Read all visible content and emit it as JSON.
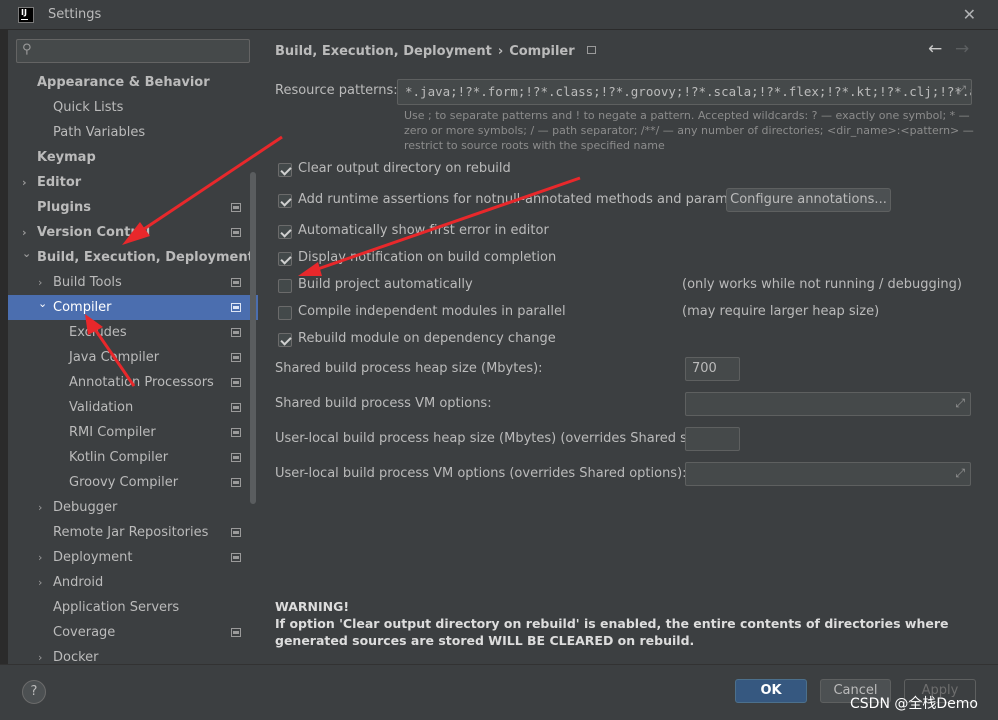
{
  "window": {
    "title": "Settings",
    "app_icon_text": "IJ"
  },
  "search": {
    "placeholder": ""
  },
  "tree": [
    {
      "label": "Appearance & Behavior",
      "bold": true,
      "indent": 0,
      "arrow": "",
      "icon": false,
      "selected": false
    },
    {
      "label": "Quick Lists",
      "bold": false,
      "indent": 1,
      "arrow": "",
      "icon": false,
      "selected": false
    },
    {
      "label": "Path Variables",
      "bold": false,
      "indent": 1,
      "arrow": "",
      "icon": false,
      "selected": false
    },
    {
      "label": "Keymap",
      "bold": true,
      "indent": 0,
      "arrow": "",
      "icon": false,
      "selected": false
    },
    {
      "label": "Editor",
      "bold": true,
      "indent": 0,
      "arrow": "right",
      "icon": false,
      "selected": false
    },
    {
      "label": "Plugins",
      "bold": true,
      "indent": 0,
      "arrow": "",
      "icon": true,
      "selected": false
    },
    {
      "label": "Version Control",
      "bold": true,
      "indent": 0,
      "arrow": "right",
      "icon": true,
      "selected": false
    },
    {
      "label": "Build, Execution, Deployment",
      "bold": true,
      "indent": 0,
      "arrow": "down",
      "icon": false,
      "selected": false
    },
    {
      "label": "Build Tools",
      "bold": false,
      "indent": 1,
      "arrow": "right",
      "icon": true,
      "selected": false
    },
    {
      "label": "Compiler",
      "bold": false,
      "indent": 1,
      "arrow": "down",
      "icon": true,
      "selected": true
    },
    {
      "label": "Excludes",
      "bold": false,
      "indent": 2,
      "arrow": "",
      "icon": true,
      "selected": false
    },
    {
      "label": "Java Compiler",
      "bold": false,
      "indent": 2,
      "arrow": "",
      "icon": true,
      "selected": false
    },
    {
      "label": "Annotation Processors",
      "bold": false,
      "indent": 2,
      "arrow": "",
      "icon": true,
      "selected": false
    },
    {
      "label": "Validation",
      "bold": false,
      "indent": 2,
      "arrow": "",
      "icon": true,
      "selected": false
    },
    {
      "label": "RMI Compiler",
      "bold": false,
      "indent": 2,
      "arrow": "",
      "icon": true,
      "selected": false
    },
    {
      "label": "Kotlin Compiler",
      "bold": false,
      "indent": 2,
      "arrow": "",
      "icon": true,
      "selected": false
    },
    {
      "label": "Groovy Compiler",
      "bold": false,
      "indent": 2,
      "arrow": "",
      "icon": true,
      "selected": false
    },
    {
      "label": "Debugger",
      "bold": false,
      "indent": 1,
      "arrow": "right",
      "icon": false,
      "selected": false
    },
    {
      "label": "Remote Jar Repositories",
      "bold": false,
      "indent": 1,
      "arrow": "",
      "icon": true,
      "selected": false
    },
    {
      "label": "Deployment",
      "bold": false,
      "indent": 1,
      "arrow": "right",
      "icon": true,
      "selected": false
    },
    {
      "label": "Android",
      "bold": false,
      "indent": 1,
      "arrow": "right",
      "icon": false,
      "selected": false
    },
    {
      "label": "Application Servers",
      "bold": false,
      "indent": 1,
      "arrow": "",
      "icon": false,
      "selected": false
    },
    {
      "label": "Coverage",
      "bold": false,
      "indent": 1,
      "arrow": "",
      "icon": true,
      "selected": false
    },
    {
      "label": "Docker",
      "bold": false,
      "indent": 1,
      "arrow": "right",
      "icon": false,
      "selected": false
    }
  ],
  "breadcrumb": {
    "parent": "Build, Execution, Deployment",
    "separator": "›",
    "current": "Compiler"
  },
  "resource_patterns": {
    "label": "Resource patterns:",
    "value": "*.java;!?*.form;!?*.class;!?*.groovy;!?*.scala;!?*.flex;!?*.kt;!?*.clj;!?*.aj",
    "hint": "Use ; to separate patterns and ! to negate a pattern. Accepted wildcards: ? — exactly one symbol; * — zero or more symbols; / — path separator; /**/ — any number of directories; <dir_name>:<pattern> — restrict to source roots with the specified name"
  },
  "options": [
    {
      "label": "Clear output directory on rebuild",
      "checked": true,
      "note": ""
    },
    {
      "label": "Add runtime assertions for notnull-annotated methods and parameters",
      "checked": true,
      "note": ""
    },
    {
      "label": "Automatically show first error in editor",
      "checked": true,
      "note": ""
    },
    {
      "label": "Display notification on build completion",
      "checked": true,
      "note": ""
    },
    {
      "label": "Build project automatically",
      "checked": false,
      "note": "(only works while not running / debugging)"
    },
    {
      "label": "Compile independent modules in parallel",
      "checked": false,
      "note": "(may require larger heap size)"
    },
    {
      "label": "Rebuild module on dependency change",
      "checked": true,
      "note": ""
    }
  ],
  "configure_annotations_label": "Configure annotations...",
  "fields": [
    {
      "label": "Shared build process heap size (Mbytes):",
      "value": "700"
    },
    {
      "label": "Shared build process VM options:",
      "value": ""
    },
    {
      "label": "User-local build process heap size (Mbytes) (overrides Shared size):",
      "value": ""
    },
    {
      "label": "User-local build process VM options (overrides Shared options):",
      "value": ""
    }
  ],
  "warning": {
    "title": "WARNING!",
    "body": "If option 'Clear output directory on rebuild' is enabled, the entire contents of directories where generated sources are stored WILL BE CLEARED on rebuild."
  },
  "footer": {
    "help": "?",
    "ok": "OK",
    "cancel": "Cancel",
    "apply": "Apply"
  },
  "watermark": "CSDN @全栈Demo",
  "colors": {
    "selection": "#4b6eaf",
    "ok_button": "#365880",
    "annotation_arrow": "#e8282b",
    "panel": "#3c3f41"
  }
}
